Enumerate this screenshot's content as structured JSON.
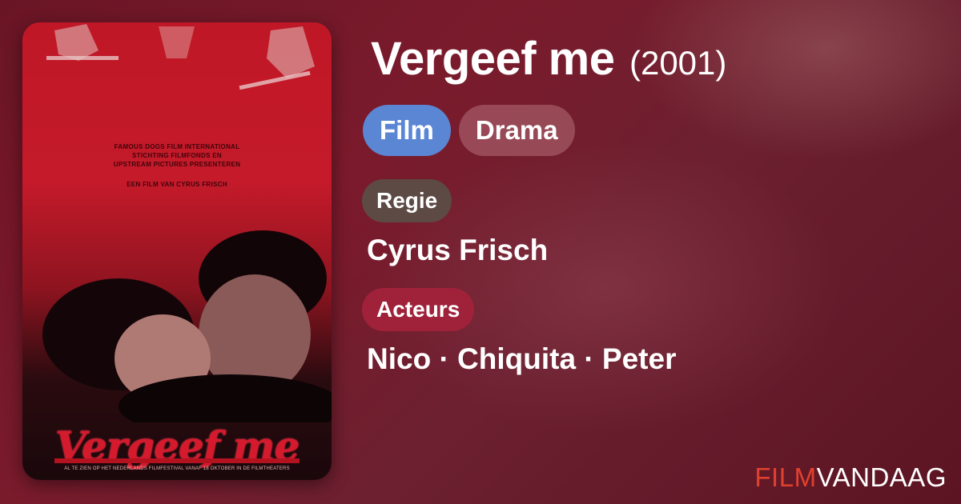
{
  "movie": {
    "title": "Vergeef me",
    "year": "(2001)",
    "tags": [
      "Film",
      "Drama"
    ]
  },
  "poster": {
    "credits": [
      "FAMOUS DOGS FILM INTERNATIONAL",
      "STICHTING FILMFONDS EN",
      "UPSTREAM PICTURES PRESENTEREN"
    ],
    "by": "EEN FILM VAN CYRUS FRISCH",
    "title": "Vergeef me",
    "tagline": "AL TE ZIEN OP HET NEDERLANDS FILMFESTIVAL VANAF 18 OKTOBER IN DE FILMTHEATERS"
  },
  "sections": {
    "director_label": "Regie",
    "director": "Cyrus Frisch",
    "actors_label": "Acteurs",
    "actors": "Nico · Chiquita · Peter"
  },
  "brand": {
    "part1": "FILM",
    "part2": "VANDAAG"
  },
  "colors": {
    "film_tag": "#5b86d4",
    "regie_label": "#5d4a44",
    "acteurs_label": "#a0213a",
    "brand_accent": "#e0412e"
  }
}
